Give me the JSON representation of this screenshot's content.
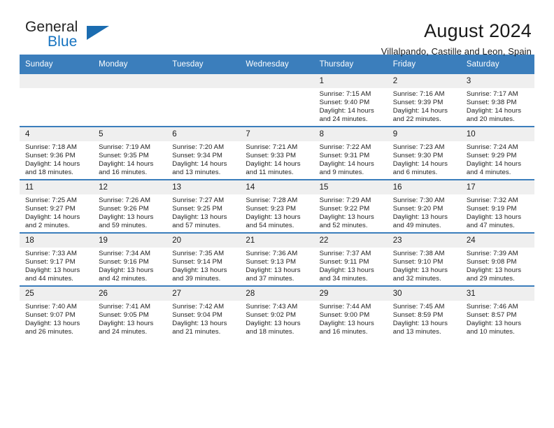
{
  "brand": {
    "name_top": "General",
    "name_bottom": "Blue",
    "triangle_color": "#1b6cb0",
    "blue_text_color": "#1673c0"
  },
  "header": {
    "title": "August 2024",
    "subtitle": "Villalpando, Castille and Leon, Spain"
  },
  "theme": {
    "header_row_bg": "#3b7ebc",
    "daynum_bg": "#efefef",
    "row_border": "#3b7ebc"
  },
  "labels": {
    "sunrise_prefix": "Sunrise: ",
    "sunset_prefix": "Sunset: ",
    "daylight_prefix": "Daylight: "
  },
  "weekdays": [
    "Sunday",
    "Monday",
    "Tuesday",
    "Wednesday",
    "Thursday",
    "Friday",
    "Saturday"
  ],
  "weeks": [
    [
      {
        "day": "",
        "blank": true,
        "sunrise": "",
        "sunset": "",
        "daylight_1": "",
        "daylight_2": ""
      },
      {
        "day": "",
        "blank": true,
        "sunrise": "",
        "sunset": "",
        "daylight_1": "",
        "daylight_2": ""
      },
      {
        "day": "",
        "blank": true,
        "sunrise": "",
        "sunset": "",
        "daylight_1": "",
        "daylight_2": ""
      },
      {
        "day": "",
        "blank": true,
        "sunrise": "",
        "sunset": "",
        "daylight_1": "",
        "daylight_2": ""
      },
      {
        "day": "1",
        "blank": false,
        "sunrise": "Sunrise: 7:15 AM",
        "sunset": "Sunset: 9:40 PM",
        "daylight_1": "Daylight: 14 hours",
        "daylight_2": "and 24 minutes."
      },
      {
        "day": "2",
        "blank": false,
        "sunrise": "Sunrise: 7:16 AM",
        "sunset": "Sunset: 9:39 PM",
        "daylight_1": "Daylight: 14 hours",
        "daylight_2": "and 22 minutes."
      },
      {
        "day": "3",
        "blank": false,
        "sunrise": "Sunrise: 7:17 AM",
        "sunset": "Sunset: 9:38 PM",
        "daylight_1": "Daylight: 14 hours",
        "daylight_2": "and 20 minutes."
      }
    ],
    [
      {
        "day": "4",
        "blank": false,
        "sunrise": "Sunrise: 7:18 AM",
        "sunset": "Sunset: 9:36 PM",
        "daylight_1": "Daylight: 14 hours",
        "daylight_2": "and 18 minutes."
      },
      {
        "day": "5",
        "blank": false,
        "sunrise": "Sunrise: 7:19 AM",
        "sunset": "Sunset: 9:35 PM",
        "daylight_1": "Daylight: 14 hours",
        "daylight_2": "and 16 minutes."
      },
      {
        "day": "6",
        "blank": false,
        "sunrise": "Sunrise: 7:20 AM",
        "sunset": "Sunset: 9:34 PM",
        "daylight_1": "Daylight: 14 hours",
        "daylight_2": "and 13 minutes."
      },
      {
        "day": "7",
        "blank": false,
        "sunrise": "Sunrise: 7:21 AM",
        "sunset": "Sunset: 9:33 PM",
        "daylight_1": "Daylight: 14 hours",
        "daylight_2": "and 11 minutes."
      },
      {
        "day": "8",
        "blank": false,
        "sunrise": "Sunrise: 7:22 AM",
        "sunset": "Sunset: 9:31 PM",
        "daylight_1": "Daylight: 14 hours",
        "daylight_2": "and 9 minutes."
      },
      {
        "day": "9",
        "blank": false,
        "sunrise": "Sunrise: 7:23 AM",
        "sunset": "Sunset: 9:30 PM",
        "daylight_1": "Daylight: 14 hours",
        "daylight_2": "and 6 minutes."
      },
      {
        "day": "10",
        "blank": false,
        "sunrise": "Sunrise: 7:24 AM",
        "sunset": "Sunset: 9:29 PM",
        "daylight_1": "Daylight: 14 hours",
        "daylight_2": "and 4 minutes."
      }
    ],
    [
      {
        "day": "11",
        "blank": false,
        "sunrise": "Sunrise: 7:25 AM",
        "sunset": "Sunset: 9:27 PM",
        "daylight_1": "Daylight: 14 hours",
        "daylight_2": "and 2 minutes."
      },
      {
        "day": "12",
        "blank": false,
        "sunrise": "Sunrise: 7:26 AM",
        "sunset": "Sunset: 9:26 PM",
        "daylight_1": "Daylight: 13 hours",
        "daylight_2": "and 59 minutes."
      },
      {
        "day": "13",
        "blank": false,
        "sunrise": "Sunrise: 7:27 AM",
        "sunset": "Sunset: 9:25 PM",
        "daylight_1": "Daylight: 13 hours",
        "daylight_2": "and 57 minutes."
      },
      {
        "day": "14",
        "blank": false,
        "sunrise": "Sunrise: 7:28 AM",
        "sunset": "Sunset: 9:23 PM",
        "daylight_1": "Daylight: 13 hours",
        "daylight_2": "and 54 minutes."
      },
      {
        "day": "15",
        "blank": false,
        "sunrise": "Sunrise: 7:29 AM",
        "sunset": "Sunset: 9:22 PM",
        "daylight_1": "Daylight: 13 hours",
        "daylight_2": "and 52 minutes."
      },
      {
        "day": "16",
        "blank": false,
        "sunrise": "Sunrise: 7:30 AM",
        "sunset": "Sunset: 9:20 PM",
        "daylight_1": "Daylight: 13 hours",
        "daylight_2": "and 49 minutes."
      },
      {
        "day": "17",
        "blank": false,
        "sunrise": "Sunrise: 7:32 AM",
        "sunset": "Sunset: 9:19 PM",
        "daylight_1": "Daylight: 13 hours",
        "daylight_2": "and 47 minutes."
      }
    ],
    [
      {
        "day": "18",
        "blank": false,
        "sunrise": "Sunrise: 7:33 AM",
        "sunset": "Sunset: 9:17 PM",
        "daylight_1": "Daylight: 13 hours",
        "daylight_2": "and 44 minutes."
      },
      {
        "day": "19",
        "blank": false,
        "sunrise": "Sunrise: 7:34 AM",
        "sunset": "Sunset: 9:16 PM",
        "daylight_1": "Daylight: 13 hours",
        "daylight_2": "and 42 minutes."
      },
      {
        "day": "20",
        "blank": false,
        "sunrise": "Sunrise: 7:35 AM",
        "sunset": "Sunset: 9:14 PM",
        "daylight_1": "Daylight: 13 hours",
        "daylight_2": "and 39 minutes."
      },
      {
        "day": "21",
        "blank": false,
        "sunrise": "Sunrise: 7:36 AM",
        "sunset": "Sunset: 9:13 PM",
        "daylight_1": "Daylight: 13 hours",
        "daylight_2": "and 37 minutes."
      },
      {
        "day": "22",
        "blank": false,
        "sunrise": "Sunrise: 7:37 AM",
        "sunset": "Sunset: 9:11 PM",
        "daylight_1": "Daylight: 13 hours",
        "daylight_2": "and 34 minutes."
      },
      {
        "day": "23",
        "blank": false,
        "sunrise": "Sunrise: 7:38 AM",
        "sunset": "Sunset: 9:10 PM",
        "daylight_1": "Daylight: 13 hours",
        "daylight_2": "and 32 minutes."
      },
      {
        "day": "24",
        "blank": false,
        "sunrise": "Sunrise: 7:39 AM",
        "sunset": "Sunset: 9:08 PM",
        "daylight_1": "Daylight: 13 hours",
        "daylight_2": "and 29 minutes."
      }
    ],
    [
      {
        "day": "25",
        "blank": false,
        "sunrise": "Sunrise: 7:40 AM",
        "sunset": "Sunset: 9:07 PM",
        "daylight_1": "Daylight: 13 hours",
        "daylight_2": "and 26 minutes."
      },
      {
        "day": "26",
        "blank": false,
        "sunrise": "Sunrise: 7:41 AM",
        "sunset": "Sunset: 9:05 PM",
        "daylight_1": "Daylight: 13 hours",
        "daylight_2": "and 24 minutes."
      },
      {
        "day": "27",
        "blank": false,
        "sunrise": "Sunrise: 7:42 AM",
        "sunset": "Sunset: 9:04 PM",
        "daylight_1": "Daylight: 13 hours",
        "daylight_2": "and 21 minutes."
      },
      {
        "day": "28",
        "blank": false,
        "sunrise": "Sunrise: 7:43 AM",
        "sunset": "Sunset: 9:02 PM",
        "daylight_1": "Daylight: 13 hours",
        "daylight_2": "and 18 minutes."
      },
      {
        "day": "29",
        "blank": false,
        "sunrise": "Sunrise: 7:44 AM",
        "sunset": "Sunset: 9:00 PM",
        "daylight_1": "Daylight: 13 hours",
        "daylight_2": "and 16 minutes."
      },
      {
        "day": "30",
        "blank": false,
        "sunrise": "Sunrise: 7:45 AM",
        "sunset": "Sunset: 8:59 PM",
        "daylight_1": "Daylight: 13 hours",
        "daylight_2": "and 13 minutes."
      },
      {
        "day": "31",
        "blank": false,
        "sunrise": "Sunrise: 7:46 AM",
        "sunset": "Sunset: 8:57 PM",
        "daylight_1": "Daylight: 13 hours",
        "daylight_2": "and 10 minutes."
      }
    ]
  ]
}
